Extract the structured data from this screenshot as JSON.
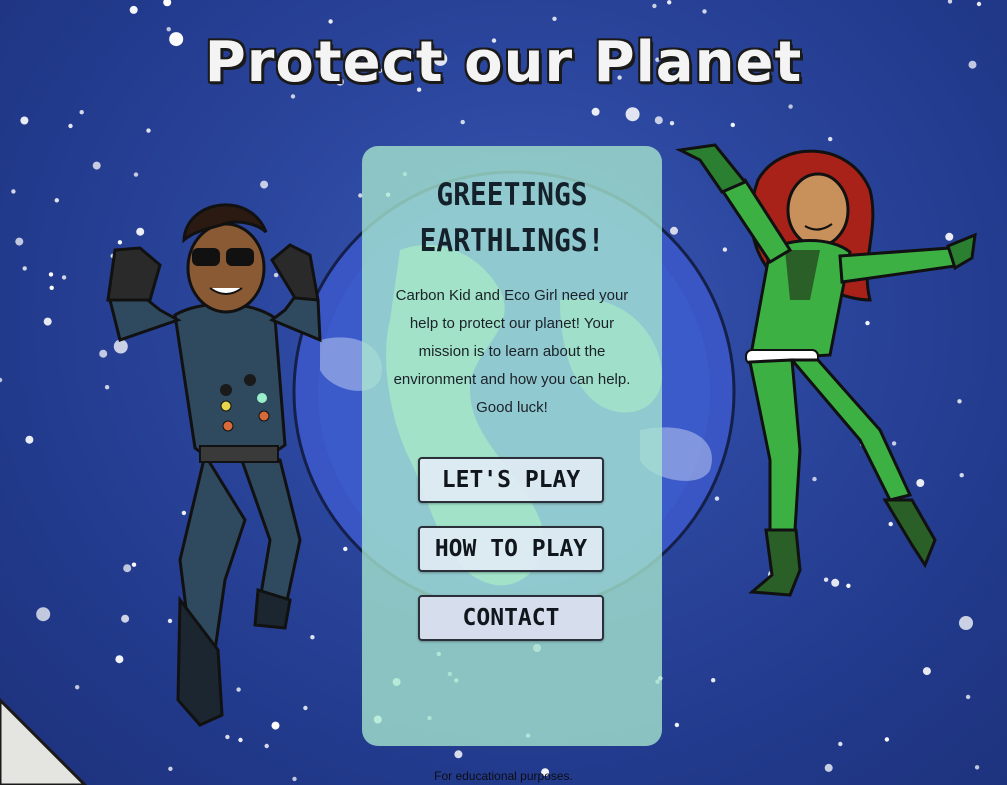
{
  "title": "Protect our Planet",
  "card": {
    "heading_line1": "GREETINGS",
    "heading_line2": "EARTHLINGS!",
    "intro": "Carbon Kid and Eco Girl need your help to protect our planet! Your mission is to learn about the environment and how you can help. Good luck!",
    "buttons": {
      "play": "LET'S PLAY",
      "how_to_play": "HOW TO PLAY",
      "contact": "CONTACT"
    }
  },
  "footer": "For educational purposes.",
  "characters": {
    "left": "Carbon Kid",
    "right": "Eco Girl"
  },
  "colors": {
    "space": "#2c479f",
    "star": "#ffffff",
    "card": "#a8e8d0",
    "eco_green": "#3cb043",
    "carbon_suit": "#2f4a5e"
  }
}
